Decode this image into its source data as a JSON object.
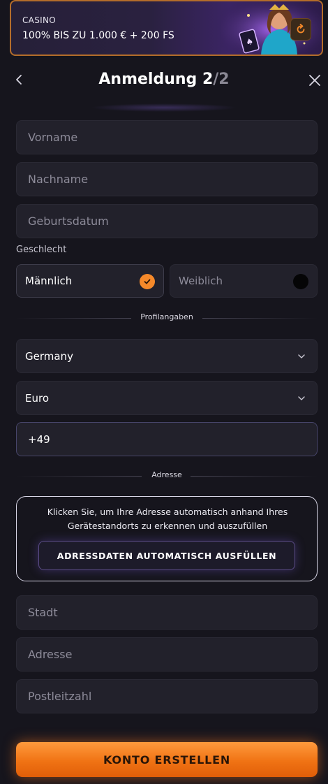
{
  "promo": {
    "category": "CASINO",
    "title": "100% BIS ZU 1.000 € + 200 FS"
  },
  "header": {
    "title_main": "Anmeldung 2",
    "title_slash": "/2"
  },
  "form": {
    "first_name_placeholder": "Vorname",
    "last_name_placeholder": "Nachname",
    "birthdate_placeholder": "Geburtsdatum",
    "gender_label": "Geschlecht",
    "gender_male": "Männlich",
    "gender_female": "Weiblich",
    "gender_selected": "Männlich",
    "profile_section": "Profilangaben",
    "country": "Germany",
    "currency": "Euro",
    "phone_prefix": "+49",
    "address_section": "Adresse",
    "autofill_hint": "Klicken Sie, um Ihre Adresse automatisch anhand Ihres Gerätestandorts zu erkennen und auszufüllen",
    "autofill_button": "ADRESSDATEN AUTOMATISCH AUSFÜLLEN",
    "city_placeholder": "Stadt",
    "address_placeholder": "Adresse",
    "zip_placeholder": "Postleitzahl",
    "submit_button": "KONTO ERSTELLEN"
  },
  "colors": {
    "accent_orange": "#f5892a",
    "background": "#16151d",
    "field_bg": "#22212b"
  },
  "icons": {
    "back": "chevron-left-icon",
    "close": "close-icon",
    "check": "check-icon",
    "refresh": "refresh-icon",
    "dropdown": "chevron-down-icon"
  }
}
